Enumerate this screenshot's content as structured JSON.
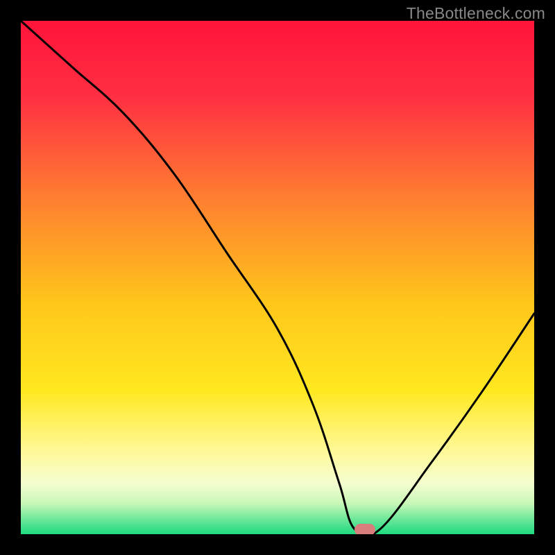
{
  "watermark": "TheBottleneck.com",
  "chart_data": {
    "type": "line",
    "title": "",
    "xlabel": "",
    "ylabel": "",
    "xlim": [
      0,
      100
    ],
    "ylim": [
      0,
      100
    ],
    "series": [
      {
        "name": "bottleneck-curve",
        "x": [
          0,
          10,
          20,
          30,
          40,
          50,
          57,
          62,
          65,
          70,
          80,
          90,
          100
        ],
        "y": [
          100,
          91,
          82,
          70,
          55,
          40,
          25,
          10,
          1,
          1,
          14,
          28,
          43
        ]
      }
    ],
    "optimal_marker": {
      "x": 67,
      "y": 1
    },
    "gradient_stops": [
      {
        "offset": 0,
        "color": "#ff143a"
      },
      {
        "offset": 15,
        "color": "#ff3042"
      },
      {
        "offset": 35,
        "color": "#ff8030"
      },
      {
        "offset": 55,
        "color": "#ffc61a"
      },
      {
        "offset": 72,
        "color": "#ffe820"
      },
      {
        "offset": 84,
        "color": "#fff99a"
      },
      {
        "offset": 90,
        "color": "#f4fecf"
      },
      {
        "offset": 94,
        "color": "#c9f7b8"
      },
      {
        "offset": 97,
        "color": "#6fe89a"
      },
      {
        "offset": 100,
        "color": "#1edb80"
      }
    ]
  }
}
